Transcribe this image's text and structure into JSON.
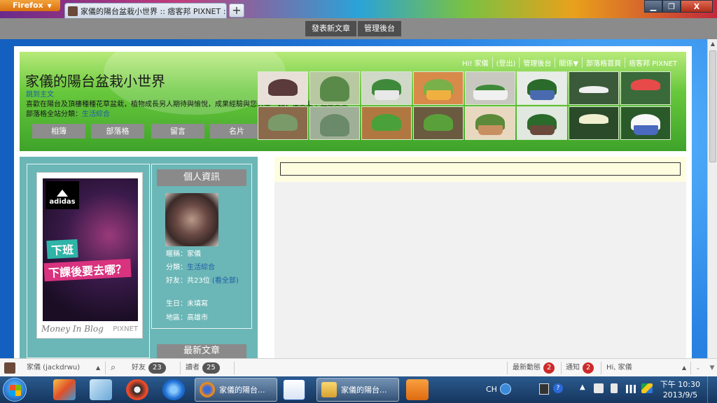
{
  "browser": {
    "app_button": "Firefox",
    "tab_title": "家儀的陽台盆栽小世界 :: 痞客邦 PIXNET ::",
    "new_tab": "+",
    "controls": {
      "minimize": "▁",
      "maximize": "❐",
      "close": "X"
    }
  },
  "adminbar": {
    "post_button": "發表新文章",
    "admin_button": "管理後台"
  },
  "header": {
    "toplinks": [
      "Hi! 家儀",
      "(登出)",
      "管理後台",
      "關係▼",
      "部落格首頁",
      "痞客邦 PIXNET"
    ],
    "title": "家儀的陽台盆栽小世界",
    "link": "跳到主文",
    "description": "喜歡在陽台及頂樓種種花草盆栽，植物成長另人期待與愉悅，成果經驗與您分享一起，獨樂樂不如眾樂樂~",
    "category_label": "部落格全站分類：",
    "category_value": "生活綜合",
    "nav": [
      "相簿",
      "部落格",
      "留言",
      "名片"
    ]
  },
  "sidebar": {
    "ad": {
      "brand": "adidas",
      "line1": "下班",
      "line2": "下課後要去哪？",
      "footer_left": "Money In Blog",
      "footer_right": "PIXNET"
    },
    "profile_heading": "個人資訊",
    "profile": {
      "nick_label": "暱稱：",
      "nick": "家儀",
      "cat_label": "分類：",
      "cat": "生活綜合",
      "friends_label": "好友：",
      "friends": "共23位",
      "friends_link": "(看全部)",
      "birthday_label": "生日：",
      "birthday": "未填寫",
      "region_label": "地區：",
      "region": "高雄市"
    },
    "latest_heading": "最新文章"
  },
  "pixbar": {
    "user": "家儀 (jackdrwu)",
    "friends_label": "好友",
    "friends_count": "23",
    "readers_label": "讀者",
    "readers_count": "25",
    "activity_label": "最新動態",
    "activity_count": "2",
    "notify_label": "通知",
    "notify_count": "2",
    "greeting": "Hi, 家儀"
  },
  "taskbar": {
    "tasks": [
      {
        "label": "家儀的陽台..."
      },
      {
        "label": "家儀的陽台..."
      }
    ],
    "ime": "CH",
    "clock_time": "下午 10:30",
    "clock_date": "2013/9/5"
  }
}
